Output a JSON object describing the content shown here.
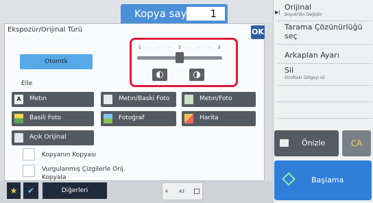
{
  "header": {
    "copy_label": "Kopya sayısı",
    "copy_value": "1"
  },
  "right_panel": {
    "items": [
      {
        "title": "Orijinal",
        "subtitle": "Boyut/Yön Değiştir"
      },
      {
        "title": "Tarama Çözünürlüğü seç",
        "subtitle": ""
      },
      {
        "title": "Arkaplan Ayarı",
        "subtitle": ""
      },
      {
        "title": "Sil",
        "subtitle": "Etraftaki Gölgeyi sil"
      }
    ],
    "preview_label": "Önizle",
    "ca_label": "CA",
    "start_label": "Başlama"
  },
  "dialog": {
    "title": "Ekspozür/Orijinal Türü",
    "ok_label": "OK",
    "auto_label": "Otomtk",
    "manual_label": "Elle",
    "exposure": {
      "scale_labels": [
        "1",
        "3",
        "5"
      ],
      "level": 3,
      "min": 1,
      "max": 5
    },
    "types": [
      {
        "label": "Metın",
        "icon": "text-icon"
      },
      {
        "label": "Metın/Baski Foto",
        "icon": "text-printed-photo-icon"
      },
      {
        "label": "Metın/Foto",
        "icon": "text-photo-icon"
      },
      {
        "label": "Basili Foto",
        "icon": "printed-photo-icon"
      },
      {
        "label": "Fotoğraf",
        "icon": "photo-icon"
      },
      {
        "label": "Harita",
        "icon": "map-icon"
      },
      {
        "label": "Açık Orijinal",
        "icon": "light-original-icon"
      }
    ],
    "checkboxes": [
      {
        "label": "Kopyanın Kopyası",
        "checked": false
      },
      {
        "label": "Vurgulanmış Çizgilerle Orij. Kopyala",
        "checked": false
      }
    ]
  },
  "bottom": {
    "others_label": "Diğerleri",
    "page_num": "4",
    "paper": "A3"
  }
}
